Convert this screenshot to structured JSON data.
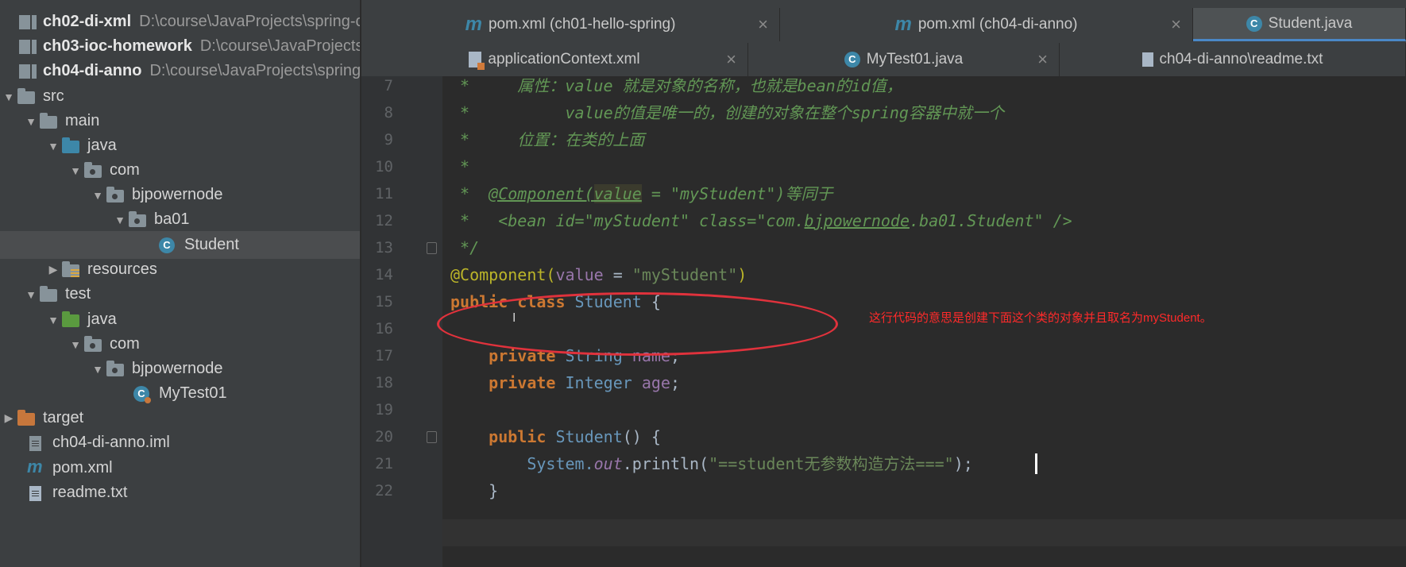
{
  "project_tree": [
    {
      "label": "ch02-di-xml",
      "path": "D:\\course\\JavaProjects\\spring-c",
      "bold": true,
      "icon": "module-icon"
    },
    {
      "label": "ch03-ioc-homework",
      "path": "D:\\course\\JavaProjects",
      "bold": true,
      "icon": "module-icon"
    },
    {
      "label": "ch04-di-anno",
      "path": "D:\\course\\JavaProjects\\spring",
      "bold": true,
      "icon": "module-icon"
    },
    {
      "label": "src",
      "icon": "folder-icon"
    },
    {
      "label": "main",
      "icon": "folder-icon"
    },
    {
      "label": "java",
      "icon": "source-folder-icon"
    },
    {
      "label": "com",
      "icon": "package-icon"
    },
    {
      "label": "bjpowernode",
      "icon": "package-icon"
    },
    {
      "label": "ba01",
      "icon": "package-icon"
    },
    {
      "label": "Student",
      "icon": "java-class-icon",
      "selected": true
    },
    {
      "label": "resources",
      "icon": "resources-folder-icon"
    },
    {
      "label": "test",
      "icon": "folder-icon"
    },
    {
      "label": "java",
      "icon": "test-source-folder-icon"
    },
    {
      "label": "com",
      "icon": "package-icon"
    },
    {
      "label": "bjpowernode",
      "icon": "package-icon"
    },
    {
      "label": "MyTest01",
      "icon": "test-class-icon"
    },
    {
      "label": "target",
      "icon": "excluded-folder-icon"
    },
    {
      "label": "ch04-di-anno.iml",
      "icon": "iml-file-icon"
    },
    {
      "label": "pom.xml",
      "icon": "maven-icon"
    },
    {
      "label": "readme.txt",
      "icon": "text-file-icon"
    }
  ],
  "tabs": [
    {
      "label": "pom.xml (ch01-hello-spring)",
      "icon": "maven-icon",
      "close": "×"
    },
    {
      "label": "pom.xml (ch04-di-anno)",
      "icon": "maven-icon",
      "close": "×"
    },
    {
      "label": "Student.java",
      "icon": "java-class-icon",
      "active": true
    },
    {
      "label": "applicationContext.xml",
      "icon": "xml-file-icon",
      "close": "×"
    },
    {
      "label": "MyTest01.java",
      "icon": "test-class-icon",
      "close": "×"
    },
    {
      "label": "ch04-di-anno\\readme.txt",
      "icon": "text-file-icon"
    }
  ],
  "code": {
    "line_numbers": [
      "7",
      "8",
      "9",
      "10",
      "11",
      "12",
      "13",
      "14",
      "15",
      "16",
      "17",
      "18",
      "19",
      "20",
      "21",
      "22"
    ],
    "l7": {
      "text": " *     属性：value 就是对象的名称，也就是bean的id值，"
    },
    "l8": {
      "text": " *          value的值是唯一的，创建的对象在整个spring容器中就一个"
    },
    "l9": {
      "text": " *     位置：在类的上面"
    },
    "l10": {
      "text": " *"
    },
    "l11": {
      "a": " *  ",
      "b": "@Component(",
      "c": "value",
      "d": " = \"myStudent\")等同于"
    },
    "l12": {
      "a": " *   <bean id=\"myStudent\" class=\"com.",
      "b": "bjpowernode",
      "c": ".ba01.Student\" />"
    },
    "l13": {
      "text": " */"
    },
    "l14": {
      "a": "@Component(",
      "b": "value",
      "c": " = ",
      "d": "\"myStudent\"",
      "e": ")"
    },
    "l15": {
      "a": "public class ",
      "b": "Student",
      "c": " {"
    },
    "l17": {
      "a": "    private ",
      "b": "String ",
      "c": "name",
      "d": ";"
    },
    "l18": {
      "a": "    private ",
      "b": "Integer ",
      "c": "age",
      "d": ";"
    },
    "l20": {
      "a": "    public ",
      "b": "Student",
      "c": "() {"
    },
    "l21": {
      "a": "        System.",
      "b": "out",
      "c": ".println(",
      "d": "\"==student无参数构造方法===\"",
      "e": ");"
    },
    "l22": {
      "text": "    }"
    }
  },
  "annotation_note": "这行代码的意思是创建下面这个类的对象并且取名为myStudent。",
  "colors": {
    "accent": "#4a88c7",
    "annotation_red": "#e0323c",
    "comment": "#629755",
    "keyword": "#cc7832"
  }
}
